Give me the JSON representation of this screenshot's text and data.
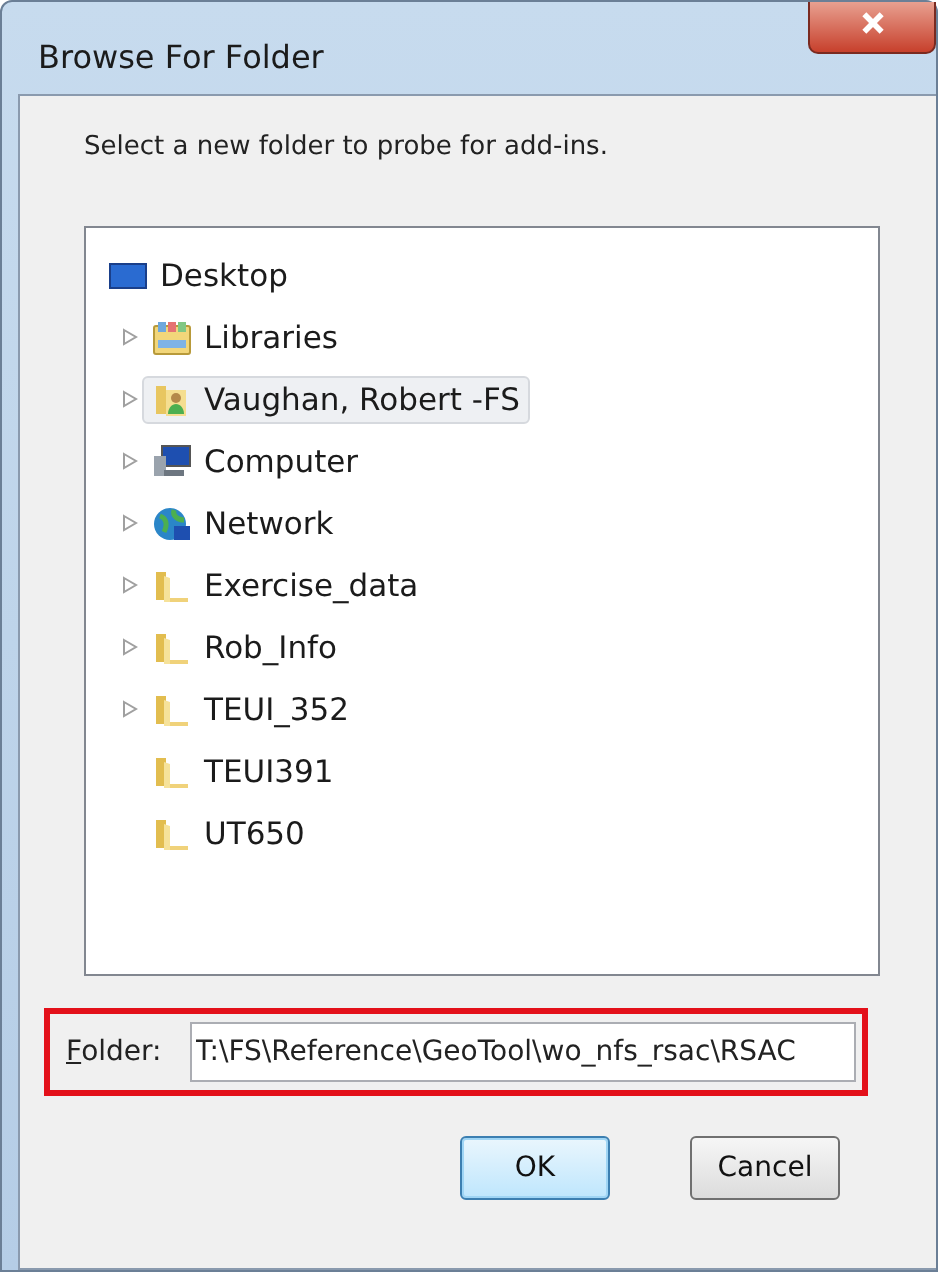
{
  "window": {
    "title": "Browse For Folder"
  },
  "instruction": "Select a new folder to probe for add-ins.",
  "tree": {
    "root": {
      "label": "Desktop",
      "kind": "desktop",
      "selected": false
    },
    "children": [
      {
        "label": "Libraries",
        "kind": "libraries",
        "expandable": true,
        "selected": false
      },
      {
        "label": "Vaughan, Robert -FS",
        "kind": "user",
        "expandable": true,
        "selected": true
      },
      {
        "label": "Computer",
        "kind": "computer",
        "expandable": true,
        "selected": false
      },
      {
        "label": "Network",
        "kind": "network",
        "expandable": true,
        "selected": false
      },
      {
        "label": "Exercise_data",
        "kind": "folder",
        "expandable": true,
        "selected": false
      },
      {
        "label": "Rob_Info",
        "kind": "folder",
        "expandable": true,
        "selected": false
      },
      {
        "label": "TEUI_352",
        "kind": "folder",
        "expandable": true,
        "selected": false
      },
      {
        "label": "TEUI391",
        "kind": "folder",
        "expandable": false,
        "selected": false
      },
      {
        "label": "UT650",
        "kind": "folder",
        "expandable": false,
        "selected": false
      }
    ]
  },
  "folder_field": {
    "label": "Folder:",
    "value": "T:\\FS\\Reference\\GeoTool\\wo_nfs_rsac\\RSAC",
    "highlighted": true
  },
  "buttons": [
    {
      "label": "OK",
      "default": true
    },
    {
      "label": "Cancel",
      "default": false
    }
  ]
}
